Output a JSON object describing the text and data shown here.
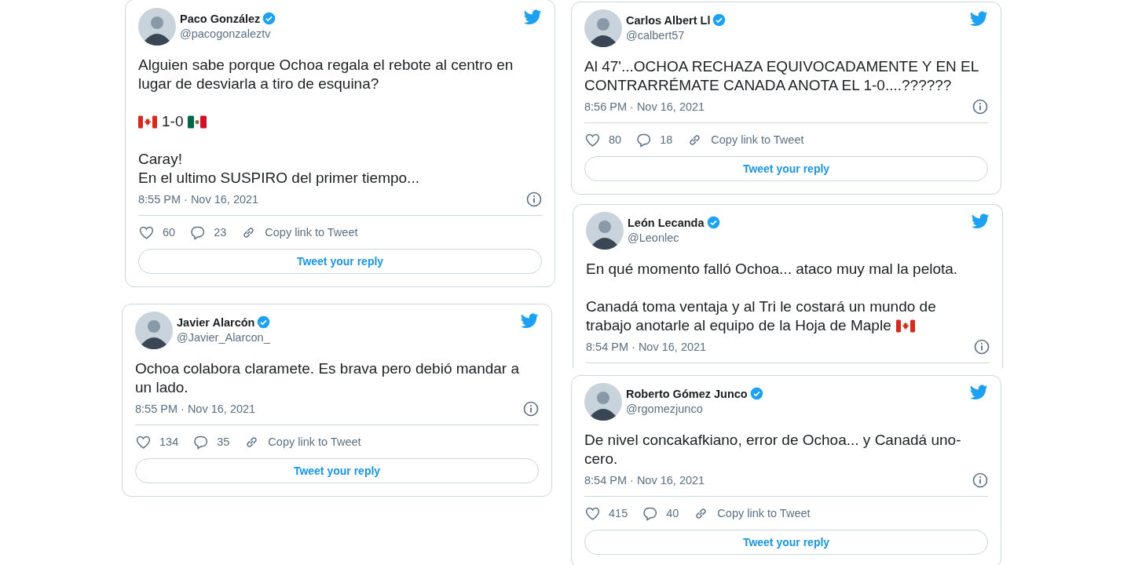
{
  "left_column": [
    {
      "name": "Paco González",
      "handle": "@pacogonzaleztv",
      "verified": true,
      "paragraphs": [
        [
          [
            {
              "kind": "text",
              "text": "Alguien sabe porque Ochoa regala el rebote al centro en lugar de desviarla a tiro de esquina?"
            }
          ]
        ],
        [
          [
            {
              "kind": "canadaflag"
            },
            {
              "kind": "text",
              "text": "1-0"
            },
            {
              "kind": "mexicoflag"
            }
          ]
        ],
        [
          [
            {
              "kind": "text",
              "text": "Caray!"
            }
          ],
          [
            {
              "kind": "text",
              "text": "En el ultimo SUSPIRO del primer tiempo..."
            }
          ]
        ]
      ],
      "timestamp": "8:55 PM · Nov 16, 2021",
      "likes": "60",
      "replies": "23",
      "copy_link": "Copy link to Tweet",
      "reply_button": "Tweet your reply"
    },
    {
      "name": "Javier Alarcón",
      "handle": "@Javier_Alarcon_",
      "verified": true,
      "paragraphs": [
        [
          [
            {
              "kind": "text",
              "text": "Ochoa colabora claramete. Es brava pero debió mandar a un lado."
            }
          ]
        ]
      ],
      "timestamp": "8:55 PM · Nov 16, 2021",
      "likes": "134",
      "replies": "35",
      "copy_link": "Copy link to Tweet",
      "reply_button": "Tweet your reply"
    }
  ],
  "right_column": [
    {
      "name": "Carlos Albert Ll",
      "handle": "@calbert57",
      "verified": true,
      "paragraphs": [
        [
          [
            {
              "kind": "text",
              "text": "Al 47'...OCHOA RECHAZA EQUIVOCADAMENTE Y EN EL CONTRARRÉMATE CANADA ANOTA EL 1-0....??????"
            }
          ]
        ]
      ],
      "timestamp": "8:56 PM · Nov 16, 2021",
      "likes": "80",
      "replies": "18",
      "copy_link": "Copy link to Tweet",
      "reply_button": "Tweet your reply"
    },
    {
      "name": "León Lecanda",
      "handle": "@Leonlec",
      "verified": true,
      "paragraphs": [
        [
          [
            {
              "kind": "text",
              "text": "En qué momento falló Ochoa... ataco muy mal la pelota."
            }
          ]
        ],
        [
          [
            {
              "kind": "text",
              "text": "Canadá toma ventaja y al Tri le costará un mundo de"
            }
          ],
          [
            {
              "kind": "text",
              "text": "trabajo anotarle al equipo de la Hoja de Maple"
            },
            {
              "kind": "canadaflag"
            }
          ]
        ]
      ],
      "timestamp": "8:54 PM · Nov 16, 2021"
    },
    {
      "name": "Roberto Gómez Junco",
      "handle": "@rgomezjunco",
      "verified": true,
      "paragraphs": [
        [
          [
            {
              "kind": "text",
              "text": "De nivel concakafkiano, error de Ochoa... y Canadá uno-cero."
            }
          ]
        ]
      ],
      "timestamp": "8:54 PM · Nov 16, 2021",
      "likes": "415",
      "replies": "40",
      "copy_link": "Copy link to Tweet",
      "reply_button": "Tweet your reply"
    }
  ]
}
